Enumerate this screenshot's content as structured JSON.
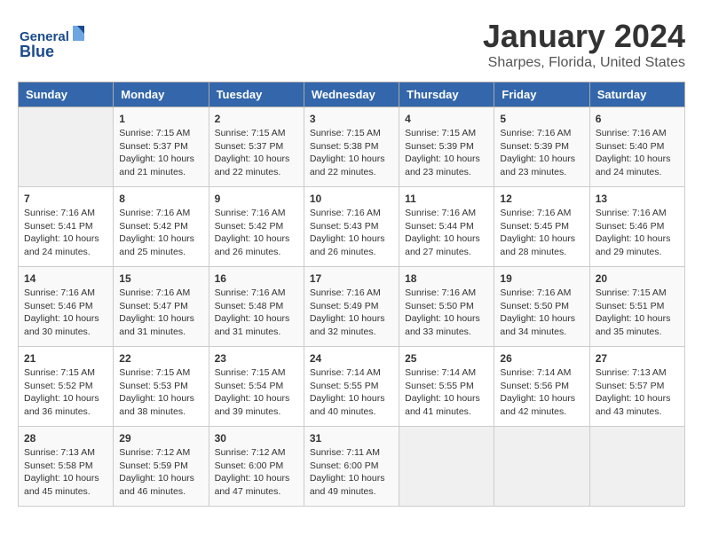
{
  "logo": {
    "line1": "General",
    "line2": "Blue"
  },
  "header": {
    "title": "January 2024",
    "subtitle": "Sharpes, Florida, United States"
  },
  "days_of_week": [
    "Sunday",
    "Monday",
    "Tuesday",
    "Wednesday",
    "Thursday",
    "Friday",
    "Saturday"
  ],
  "weeks": [
    [
      {
        "day": null,
        "content": null
      },
      {
        "day": "1",
        "sunrise": "7:15 AM",
        "sunset": "5:37 PM",
        "daylight": "10 hours and 21 minutes."
      },
      {
        "day": "2",
        "sunrise": "7:15 AM",
        "sunset": "5:37 PM",
        "daylight": "10 hours and 22 minutes."
      },
      {
        "day": "3",
        "sunrise": "7:15 AM",
        "sunset": "5:38 PM",
        "daylight": "10 hours and 22 minutes."
      },
      {
        "day": "4",
        "sunrise": "7:15 AM",
        "sunset": "5:39 PM",
        "daylight": "10 hours and 23 minutes."
      },
      {
        "day": "5",
        "sunrise": "7:16 AM",
        "sunset": "5:39 PM",
        "daylight": "10 hours and 23 minutes."
      },
      {
        "day": "6",
        "sunrise": "7:16 AM",
        "sunset": "5:40 PM",
        "daylight": "10 hours and 24 minutes."
      }
    ],
    [
      {
        "day": "7",
        "sunrise": "7:16 AM",
        "sunset": "5:41 PM",
        "daylight": "10 hours and 24 minutes."
      },
      {
        "day": "8",
        "sunrise": "7:16 AM",
        "sunset": "5:42 PM",
        "daylight": "10 hours and 25 minutes."
      },
      {
        "day": "9",
        "sunrise": "7:16 AM",
        "sunset": "5:42 PM",
        "daylight": "10 hours and 26 minutes."
      },
      {
        "day": "10",
        "sunrise": "7:16 AM",
        "sunset": "5:43 PM",
        "daylight": "10 hours and 26 minutes."
      },
      {
        "day": "11",
        "sunrise": "7:16 AM",
        "sunset": "5:44 PM",
        "daylight": "10 hours and 27 minutes."
      },
      {
        "day": "12",
        "sunrise": "7:16 AM",
        "sunset": "5:45 PM",
        "daylight": "10 hours and 28 minutes."
      },
      {
        "day": "13",
        "sunrise": "7:16 AM",
        "sunset": "5:46 PM",
        "daylight": "10 hours and 29 minutes."
      }
    ],
    [
      {
        "day": "14",
        "sunrise": "7:16 AM",
        "sunset": "5:46 PM",
        "daylight": "10 hours and 30 minutes."
      },
      {
        "day": "15",
        "sunrise": "7:16 AM",
        "sunset": "5:47 PM",
        "daylight": "10 hours and 31 minutes."
      },
      {
        "day": "16",
        "sunrise": "7:16 AM",
        "sunset": "5:48 PM",
        "daylight": "10 hours and 31 minutes."
      },
      {
        "day": "17",
        "sunrise": "7:16 AM",
        "sunset": "5:49 PM",
        "daylight": "10 hours and 32 minutes."
      },
      {
        "day": "18",
        "sunrise": "7:16 AM",
        "sunset": "5:50 PM",
        "daylight": "10 hours and 33 minutes."
      },
      {
        "day": "19",
        "sunrise": "7:16 AM",
        "sunset": "5:50 PM",
        "daylight": "10 hours and 34 minutes."
      },
      {
        "day": "20",
        "sunrise": "7:15 AM",
        "sunset": "5:51 PM",
        "daylight": "10 hours and 35 minutes."
      }
    ],
    [
      {
        "day": "21",
        "sunrise": "7:15 AM",
        "sunset": "5:52 PM",
        "daylight": "10 hours and 36 minutes."
      },
      {
        "day": "22",
        "sunrise": "7:15 AM",
        "sunset": "5:53 PM",
        "daylight": "10 hours and 38 minutes."
      },
      {
        "day": "23",
        "sunrise": "7:15 AM",
        "sunset": "5:54 PM",
        "daylight": "10 hours and 39 minutes."
      },
      {
        "day": "24",
        "sunrise": "7:14 AM",
        "sunset": "5:55 PM",
        "daylight": "10 hours and 40 minutes."
      },
      {
        "day": "25",
        "sunrise": "7:14 AM",
        "sunset": "5:55 PM",
        "daylight": "10 hours and 41 minutes."
      },
      {
        "day": "26",
        "sunrise": "7:14 AM",
        "sunset": "5:56 PM",
        "daylight": "10 hours and 42 minutes."
      },
      {
        "day": "27",
        "sunrise": "7:13 AM",
        "sunset": "5:57 PM",
        "daylight": "10 hours and 43 minutes."
      }
    ],
    [
      {
        "day": "28",
        "sunrise": "7:13 AM",
        "sunset": "5:58 PM",
        "daylight": "10 hours and 45 minutes."
      },
      {
        "day": "29",
        "sunrise": "7:12 AM",
        "sunset": "5:59 PM",
        "daylight": "10 hours and 46 minutes."
      },
      {
        "day": "30",
        "sunrise": "7:12 AM",
        "sunset": "6:00 PM",
        "daylight": "10 hours and 47 minutes."
      },
      {
        "day": "31",
        "sunrise": "7:11 AM",
        "sunset": "6:00 PM",
        "daylight": "10 hours and 49 minutes."
      },
      null,
      null,
      null
    ]
  ],
  "labels": {
    "sunrise": "Sunrise:",
    "sunset": "Sunset:",
    "daylight": "Daylight:"
  }
}
